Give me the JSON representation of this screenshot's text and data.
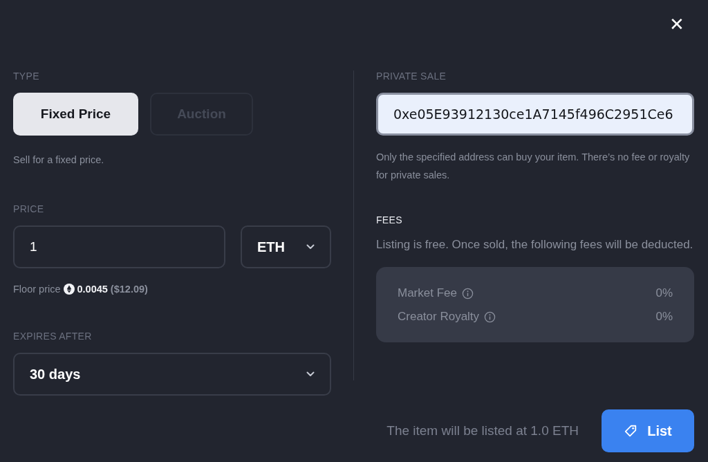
{
  "close": "✕",
  "type": {
    "label": "TYPE",
    "options": [
      {
        "label": "Fixed Price",
        "selected": true
      },
      {
        "label": "Auction",
        "selected": false
      }
    ],
    "help": "Sell for a fixed price."
  },
  "price": {
    "label": "PRICE",
    "value": "1",
    "currency": "ETH",
    "floor_label": "Floor price",
    "floor_value": "0.0045",
    "floor_usd": "($12.09)"
  },
  "expires": {
    "label": "EXPIRES AFTER",
    "value": "30 days"
  },
  "private_sale": {
    "label": "PRIVATE SALE",
    "value": "0xe05E93912130ce1A7145f496C2951Ce6",
    "focused": true,
    "help": "Only the specified address can buy your item. There’s no fee or royalty for private sales."
  },
  "fees": {
    "label": "FEES",
    "text": "Listing is free. Once sold, the following fees will be deducted.",
    "rows": [
      {
        "name": "Market Fee",
        "value": "0%"
      },
      {
        "name": "Creator Royalty",
        "value": "0%"
      }
    ]
  },
  "footer": {
    "summary": "The item will be listed at 1.0 ETH",
    "button": "List"
  }
}
